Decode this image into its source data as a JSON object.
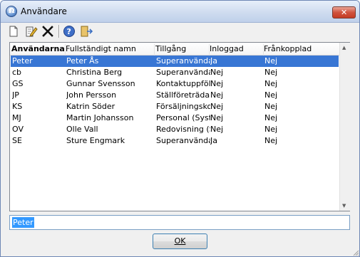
{
  "window": {
    "title": "Användare",
    "close_glyph": "✕"
  },
  "toolbar": {
    "icons": [
      "new-document-icon",
      "edit-icon",
      "delete-icon",
      "help-icon",
      "exit-icon"
    ]
  },
  "table": {
    "headers": [
      "Användarnamn",
      "Fullständigt namn",
      "Tillgång",
      "Inloggad",
      "Frånkopplad"
    ],
    "rows": [
      [
        "Peter",
        "Peter Ås",
        "Superanvändare",
        "Ja",
        "Nej"
      ],
      [
        "cb",
        "Christina Berg",
        "Superanvändare",
        "Nej",
        "Nej"
      ],
      [
        "GS",
        "Gunnar Svensson",
        "Kontaktuppföljning",
        "Nej",
        "Nej"
      ],
      [
        "JP",
        "John Persson",
        "Ställföreträdande",
        "Nej",
        "Nej"
      ],
      [
        "KS",
        "Katrin Söder",
        "Försäljningskonsult",
        "Nej",
        "Nej"
      ],
      [
        "MJ",
        "Martin Johansson",
        "Personal (System)",
        "Nej",
        "Nej"
      ],
      [
        "OV",
        "Olle Vall",
        "Redovisning (System)",
        "Nej",
        "Nej"
      ],
      [
        "SE",
        "Sture Engmark",
        "Superanvändare",
        "Ja",
        "Nej"
      ]
    ],
    "selected_index": 0
  },
  "search": {
    "value": "Peter"
  },
  "buttons": {
    "ok": "OK"
  },
  "colors": {
    "selection": "#3876d4",
    "close": "#c53b23"
  }
}
